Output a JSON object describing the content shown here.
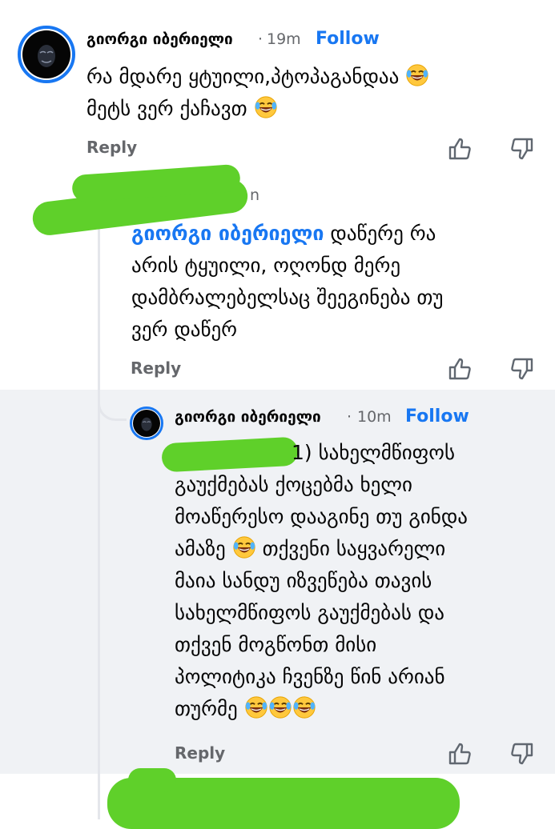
{
  "colors": {
    "accent": "#1877f2",
    "scribble": "#5fd02a",
    "nested_bg": "#f0f2f5",
    "meta": "#65676b"
  },
  "comments": [
    {
      "author": "გიორგი იბერიელი",
      "separator": "·",
      "time": "19m",
      "follow_label": "Follow",
      "lines": [
        "რა მდარე ყტუილი,პტოპაგანდაა",
        "მეტს ვერ ქაჩავთ"
      ],
      "emojis": [
        "laughing-tears-emoji",
        "laughing-tears-emoji"
      ],
      "reply_label": "Reply",
      "icons": [
        "thumbs-up-icon",
        "thumbs-down-icon"
      ]
    },
    {
      "author_hidden": true,
      "time_fragment": "n",
      "mention": "გიორგი იბერიელი",
      "text_line1": "დაწერე რა",
      "lines_rest": [
        "არის ტყუილი, ოღონდ მერე",
        "დამბრალებელსაც შეეგინება თუ",
        "ვერ დაწერ"
      ],
      "reply_label": "Reply",
      "icons": [
        "thumbs-up-icon",
        "thumbs-down-icon"
      ]
    },
    {
      "author": "გიორგი იბერიელი",
      "separator": "·",
      "time": "10m",
      "follow_label": "Follow",
      "first_line_visible": "1) სახელმწიფოს",
      "line2": "გაუქმებას ქოცებმა ხელი",
      "line3": "მოაწერესო დააგინე თუ გინდა",
      "line4_a": "ამაზე",
      "line4_b": "თქვენი საყვარელი",
      "line5": "მაია სანდუ იზვეწება თავის",
      "line6": "სახელმწიფოს გაუქმებას და",
      "line7": "თქვენ მოგწონთ მისი",
      "line8": "პოლიტიკა ჩვენზე წინ არიან",
      "line9": "თურმე",
      "reply_label": "Reply",
      "icons": [
        "thumbs-up-icon",
        "thumbs-down-icon"
      ]
    }
  ]
}
